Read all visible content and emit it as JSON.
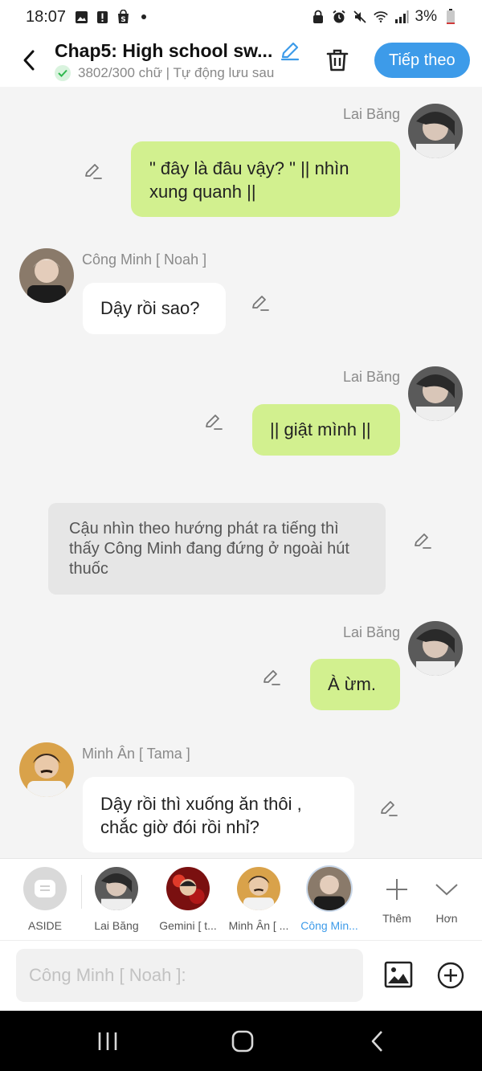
{
  "status_bar": {
    "time": "18:07",
    "battery": "3%"
  },
  "header": {
    "title": "Chap5: High school sw...",
    "subtitle": "3802/300 chữ | Tự động lưu sau",
    "next_label": "Tiếp theo"
  },
  "messages": [
    {
      "type": "me",
      "sender": "Lai Băng",
      "text": "\" đây là đâu vậy? \" || nhìn xung quanh ||"
    },
    {
      "type": "other",
      "sender": "Công Minh [ Noah ]",
      "text": "Dậy rồi sao?"
    },
    {
      "type": "me",
      "sender": "Lai Băng",
      "text": "|| giật mình ||"
    },
    {
      "type": "narration",
      "text": "Cậu nhìn theo hướng phát ra tiếng thì thấy Công Minh đang đứng ở ngoài hút thuốc"
    },
    {
      "type": "me",
      "sender": "Lai Băng",
      "text": "À ừm."
    },
    {
      "type": "other",
      "sender": "Minh Ân [ Tama ]",
      "text": "Dậy rồi thì xuống ăn thôi , chắc giờ đói rồi nhỉ?"
    }
  ],
  "characters": [
    {
      "label": "ASIDE"
    },
    {
      "label": "Lai Băng"
    },
    {
      "label": "Gemini [ t..."
    },
    {
      "label": "Minh Ân [ ..."
    },
    {
      "label": "Công Min...",
      "active": true
    }
  ],
  "tools": {
    "more_label": "Thêm",
    "less_label": "Hơn"
  },
  "input": {
    "placeholder": "Công Minh [ Noah ]:"
  },
  "colors": {
    "accent": "#3d9be9",
    "me_bubble": "#d2f08f",
    "other_bubble": "#ffffff",
    "narration_bubble": "#e6e6e6"
  }
}
